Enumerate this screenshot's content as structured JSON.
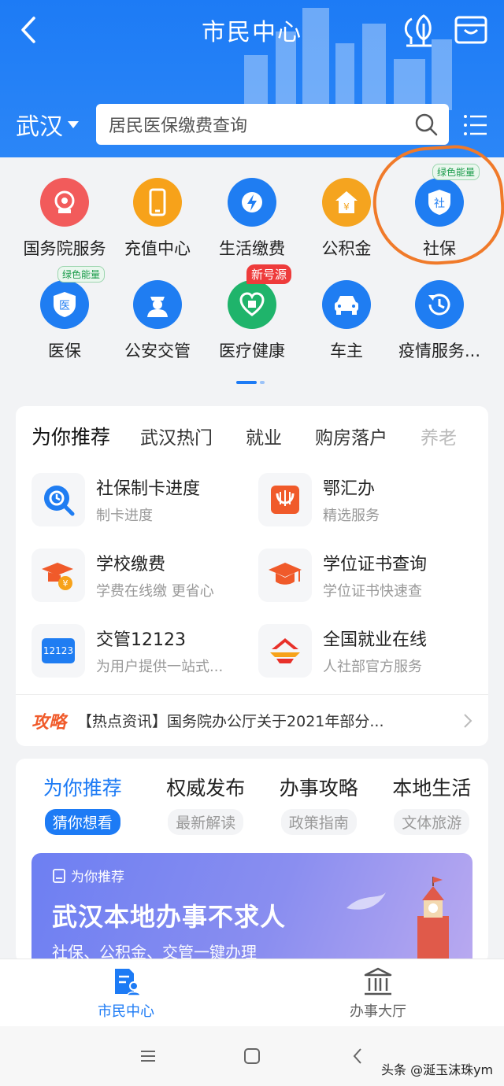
{
  "header": {
    "title": "市民中心",
    "city": "武汉",
    "search_placeholder": "居民医保缴费查询"
  },
  "services": [
    {
      "label": "国务院服务",
      "icon": "state-council-icon",
      "color": "#f25b5b"
    },
    {
      "label": "充值中心",
      "icon": "phone-recharge-icon",
      "color": "#f7a21a"
    },
    {
      "label": "生活缴费",
      "icon": "utility-payment-icon",
      "color": "#1f7df2"
    },
    {
      "label": "公积金",
      "icon": "housing-fund-icon",
      "color": "#f5a41f"
    },
    {
      "label": "社保",
      "icon": "social-security-icon",
      "color": "#1f7df2",
      "badge": "绿色能量"
    },
    {
      "label": "医保",
      "icon": "medical-insurance-icon",
      "color": "#1f7df2",
      "badge": "绿色能量"
    },
    {
      "label": "公安交管",
      "icon": "police-icon",
      "color": "#1f7df2"
    },
    {
      "label": "医疗健康",
      "icon": "health-icon",
      "color": "#1fb46b",
      "badge_new": "新号源"
    },
    {
      "label": "车主",
      "icon": "car-icon",
      "color": "#1f7df2"
    },
    {
      "label": "疫情服务...",
      "icon": "epidemic-clock-icon",
      "color": "#1f7df2"
    }
  ],
  "recommend": {
    "tabs": [
      "为你推荐",
      "武汉热门",
      "就业",
      "购房落户",
      "养老"
    ],
    "items": [
      {
        "title": "社保制卡进度",
        "desc": "制卡进度",
        "icon": "card-progress-icon"
      },
      {
        "title": "鄂汇办",
        "desc": "精选服务",
        "icon": "ehuiban-icon"
      },
      {
        "title": "学校缴费",
        "desc": "学费在线缴 更省心",
        "icon": "school-fee-icon"
      },
      {
        "title": "学位证书查询",
        "desc": "学位证书快速查",
        "icon": "degree-cap-icon"
      },
      {
        "title": "交管12123",
        "desc": "为用户提供一站式...",
        "icon": "traffic-12123-icon"
      },
      {
        "title": "全国就业在线",
        "desc": "人社部官方服务",
        "icon": "employment-icon"
      }
    ],
    "news_tag": "攻略",
    "news_text": "【热点资讯】国务院办公厅关于2021年部分..."
  },
  "feed": {
    "tabs": [
      {
        "main": "为你推荐",
        "sub": "猜你想看"
      },
      {
        "main": "权威发布",
        "sub": "最新解读"
      },
      {
        "main": "办事攻略",
        "sub": "政策指南"
      },
      {
        "main": "本地生活",
        "sub": "文体旅游"
      }
    ],
    "banner": {
      "label": "为你推荐",
      "title": "武汉本地办事不求人",
      "subtitle": "社保、公积金、交管一键办理"
    }
  },
  "tabbar": {
    "left": "市民中心",
    "right": "办事大厅"
  },
  "colors": {
    "primary": "#1d7bf5",
    "highlight": "#f07a2a"
  },
  "watermark": "头条 @涎玉沫珠ym"
}
